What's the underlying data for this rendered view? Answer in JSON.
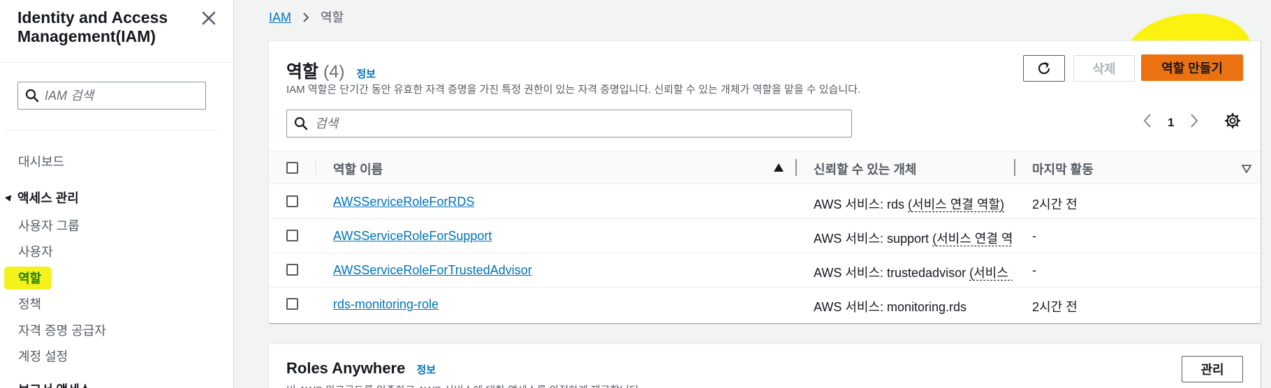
{
  "sidebar": {
    "title": "Identity and Access Management(IAM)",
    "search_placeholder": "IAM 검색",
    "dashboard": "대시보드",
    "section_access": "액세스 관리",
    "items": [
      "사용자 그룹",
      "사용자",
      "역할",
      "정책",
      "자격 증명 공급자",
      "계정 설정"
    ],
    "active_item": "역할",
    "next_section_partial": "보고서 액세스"
  },
  "breadcrumb": {
    "root": "IAM",
    "current": "역할"
  },
  "roles_panel": {
    "title": "역할",
    "count": "(4)",
    "info_label": "정보",
    "description": "IAM 역할은 단기간 동안 유효한 자격 증명을 가진 특정 권한이 있는 자격 증명입니다. 신뢰할 수 있는 개체가 역할을 맡을 수 있습니다.",
    "delete_label": "삭제",
    "create_label": "역할 만들기",
    "search_placeholder": "검색",
    "page_number": "1",
    "columns": {
      "name": "역할 이름",
      "trusted": "신뢰할 수 있는 개체",
      "last_activity": "마지막 활동"
    },
    "rows": [
      {
        "name": "AWSServiceRoleForRDS",
        "trusted_prefix": "AWS 서비스: rds",
        "trusted_link": "(서비스 연결 역할)",
        "last": "2시간 전"
      },
      {
        "name": "AWSServiceRoleForSupport",
        "trusted_prefix": "AWS 서비스: support",
        "trusted_link": "(서비스 연결 역할)",
        "last": "-"
      },
      {
        "name": "AWSServiceRoleForTrustedAdvisor",
        "trusted_prefix": "AWS 서비스: trustedadvisor",
        "trusted_link": "(서비스 연결 역할)",
        "last": "-"
      },
      {
        "name": "rds-monitoring-role",
        "trusted_prefix": "AWS 서비스: monitoring.rds",
        "trusted_link": "",
        "last": "2시간 전"
      }
    ]
  },
  "roles_anywhere": {
    "title": "Roles Anywhere",
    "info_label": "정보",
    "description": "비 AWS 워크로드를 인증하고 AWS 서비스에 대한 액세스를 안전하게 제공합니다.",
    "manage_label": "관리"
  },
  "colors": {
    "accent": "#0073bb",
    "primary_button": "#ec7211",
    "highlight": "#f4f21c",
    "active_nav": "#1d8102"
  }
}
